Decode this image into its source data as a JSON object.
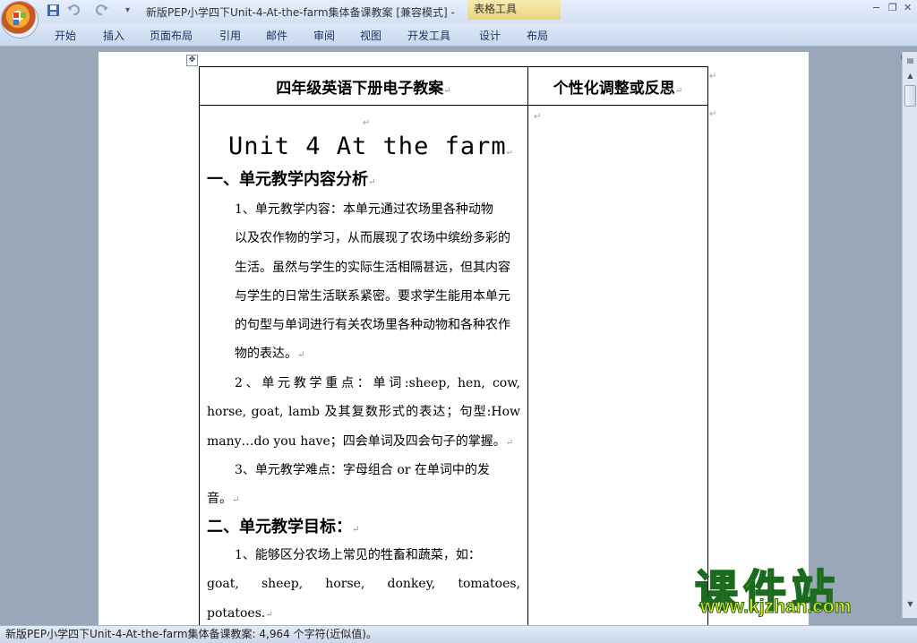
{
  "window": {
    "title": "新版PEP小学四下Unit-4-At-the-farm集体备课教案 [兼容模式] -",
    "context_label": "表格工具",
    "minimize": "−",
    "restore": "❐",
    "close": "✕"
  },
  "qat": {
    "save_icon": "save-icon",
    "undo_icon": "undo-icon",
    "redo_icon": "redo-icon",
    "more": "▾"
  },
  "ribbon": {
    "tabs": [
      "开始",
      "插入",
      "页面布局",
      "引用",
      "邮件",
      "审阅",
      "视图",
      "开发工具",
      "设计",
      "布局"
    ],
    "help": "?"
  },
  "table": {
    "move_handle": "✥",
    "header_left": "四年级英语下册电子教案",
    "header_right": "个性化调整或反思",
    "mark": "↵"
  },
  "content": {
    "unit_title": "Unit 4  At the farm",
    "section1": "一、单元教学内容分析",
    "para1": [
      "1、单元教学内容：本单元通过农场里各种动物",
      "以及农作物的学习，从而展现了农场中缤纷多彩的",
      "生活。虽然与学生的实际生活相隔甚远，但其内容",
      "与学生的日常生活联系紧密。要求学生能用本单元",
      "的句型与单词进行有关农场里各种动物和各种农作",
      "物的表达。"
    ],
    "para2": [
      "2、单元教学重点：单词:sheep, hen, cow,",
      "horse, goat, lamb 及其复数形式的表达；句型:How",
      "many…do you have；四会单词及四会句子的掌握。"
    ],
    "para3": [
      "3、单元教学难点：字母组合 or 在单词中的发",
      "音。"
    ],
    "section2": "二、单元教学目标：",
    "para4": [
      "1、能够区分农场上常见的牲畜和蔬菜，如：",
      "goat,  sheep,  horse,  donkey,  tomatoes,",
      "potatoes."
    ]
  },
  "watermark": {
    "main": "课件站",
    "url": "www.kjzhan.com"
  },
  "status": {
    "text": "新版PEP小学四下Unit-4-At-the-farm集体备课教案: 4,964 个字符(近似值)。"
  },
  "colors": {
    "ribbon": "#d3e0f3",
    "context_tab": "#e9d477",
    "watermark_fill": "#f2e61a",
    "watermark_stroke": "#1b6b1f"
  }
}
